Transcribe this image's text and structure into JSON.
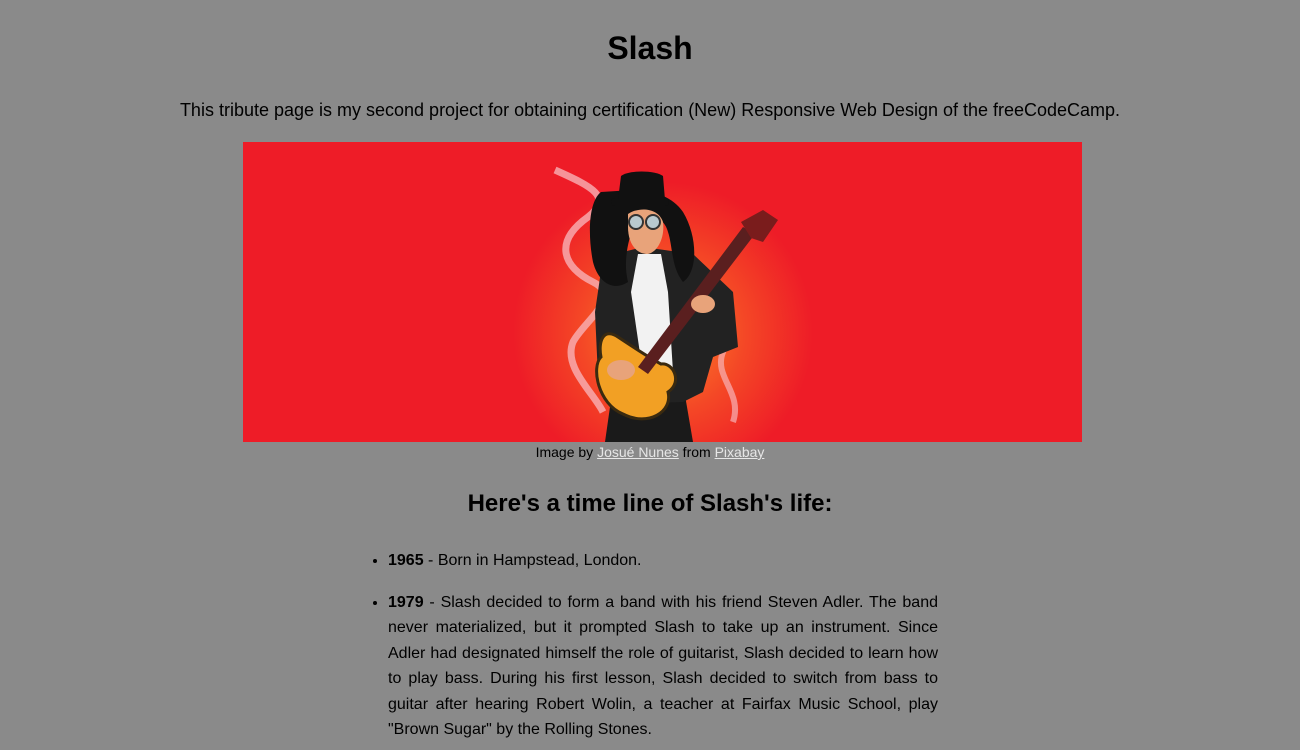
{
  "header": {
    "title": "Slash",
    "intro": "This tribute page is my second project for obtaining certification (New) Responsive Web Design of the freeCodeCamp."
  },
  "image": {
    "caption_prefix": "Image by ",
    "author_link": "Josué Nunes",
    "caption_middle": " from ",
    "source_link": "Pixabay",
    "background_color": "#ee1c27"
  },
  "timeline": {
    "heading": "Here's a time line of Slash's life:",
    "items": [
      {
        "year": "1965",
        "text": " - Born in Hampstead, London."
      },
      {
        "year": "1979",
        "text": " - Slash decided to form a band with his friend Steven Adler. The band never materialized, but it prompted Slash to take up an instrument. Since Adler had designated himself the role of guitarist, Slash decided to learn how to play bass. During his first lesson, Slash decided to switch from bass to guitar after hearing Robert Wolin, a teacher at Fairfax Music School, play \"Brown Sugar\" by the Rolling Stones."
      }
    ]
  }
}
